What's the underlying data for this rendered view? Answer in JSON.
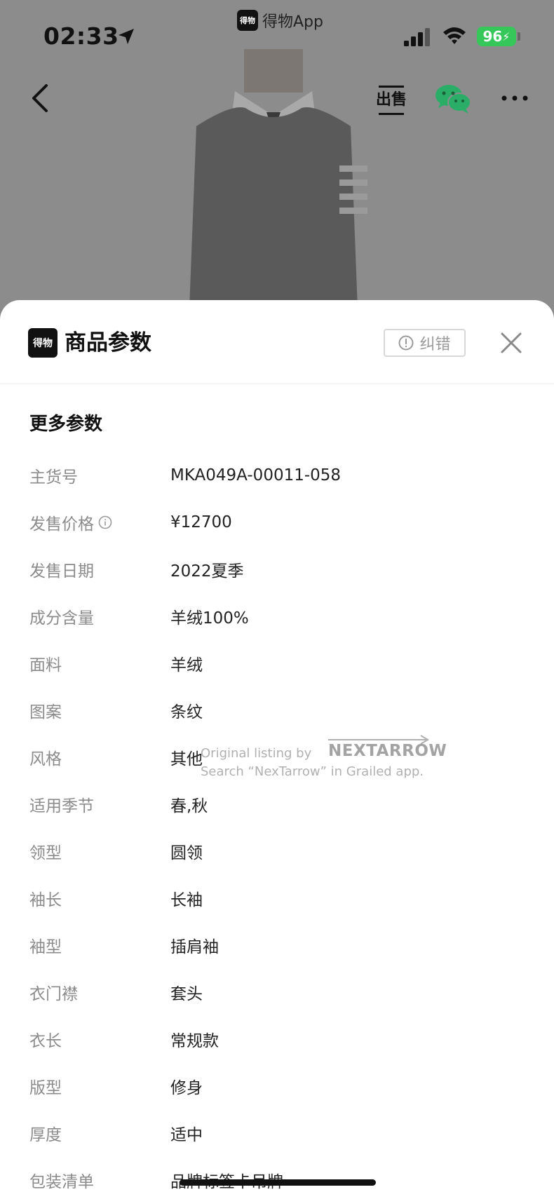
{
  "status_bar": {
    "time": "02:33",
    "app_badge_logo": "得物",
    "app_badge_text": "得物App",
    "battery": "96"
  },
  "nav": {
    "sell_label": "出售",
    "icons": [
      "back-icon",
      "wechat-icon",
      "more-icon"
    ]
  },
  "sheet": {
    "logo_text": "得物",
    "title": "商品参数",
    "report_label": "纠错",
    "section_title": "更多参数",
    "params": [
      {
        "key": "主货号",
        "value": "MKA049A-00011-058",
        "has_info": false
      },
      {
        "key": "发售价格",
        "value": "¥12700",
        "has_info": true
      },
      {
        "key": "发售日期",
        "value": "2022夏季",
        "has_info": false
      },
      {
        "key": "成分含量",
        "value": "羊绒100%",
        "has_info": false
      },
      {
        "key": "面料",
        "value": "羊绒",
        "has_info": false
      },
      {
        "key": "图案",
        "value": "条纹",
        "has_info": false
      },
      {
        "key": "风格",
        "value": "其他",
        "has_info": false
      },
      {
        "key": "适用季节",
        "value": "春,秋",
        "has_info": false
      },
      {
        "key": "领型",
        "value": "圆领",
        "has_info": false
      },
      {
        "key": "袖长",
        "value": "长袖",
        "has_info": false
      },
      {
        "key": "袖型",
        "value": "插肩袖",
        "has_info": false
      },
      {
        "key": "衣门襟",
        "value": "套头",
        "has_info": false
      },
      {
        "key": "衣长",
        "value": "常规款",
        "has_info": false
      },
      {
        "key": "版型",
        "value": "修身",
        "has_info": false
      },
      {
        "key": "厚度",
        "value": "适中",
        "has_info": false
      },
      {
        "key": "包装清单",
        "value": "品牌标签卡吊牌",
        "has_info": false
      }
    ]
  },
  "watermark": {
    "line1": "Original listing by",
    "brand": "NEXTARROW",
    "line2": "Search “NexTarrow” in Grailed app."
  },
  "colors": {
    "battery": "#35c759",
    "wechat": "#2aae67",
    "backdrop": "#8c8c8c"
  }
}
